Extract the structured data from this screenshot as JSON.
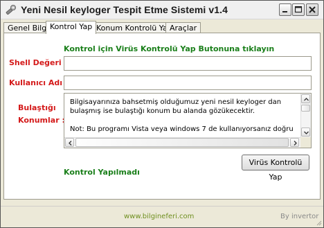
{
  "window": {
    "title": "Yeni Nesil keyloger Tespit Etme Sistemi v1.4",
    "icon": "wrench-icon"
  },
  "tabs": [
    {
      "label": "Genel Bilgi",
      "active": false
    },
    {
      "label": "Kontrol Yap",
      "active": true
    },
    {
      "label": "Konum Kontrolü Yap",
      "active": false
    },
    {
      "label": "Araçlar",
      "active": false
    }
  ],
  "panel": {
    "headline": "Kontrol  için Virüs Kontrolü Yap Butonuna tıklayın",
    "shell_label": "Shell Değeri :",
    "shell_value": "",
    "user_label": "Kullanıcı Adı :",
    "user_value": "",
    "location_label_line1": "Bulaştığı",
    "location_label_line2": "Konumlar :",
    "location_text": "Bilgisayarınıza bahsetmiş olduğumuz  yeni nesil keyloger dan\nbulaşmış ise bulaştığı konum bu alanda gözükecektir.\n\nNot: Bu programı  Vista veya windows 7 de kullanıyorsanız  doğru",
    "scan_button": "Virüs Kontrolü Yap",
    "status": "Kontrol Yapılmadı"
  },
  "footer": {
    "link": "www.bilgineferi.com",
    "by": "By invertor"
  },
  "colors": {
    "label_red": "#d41a1a",
    "status_green": "#1a7f1a",
    "footer_link": "#6f8f1f"
  }
}
